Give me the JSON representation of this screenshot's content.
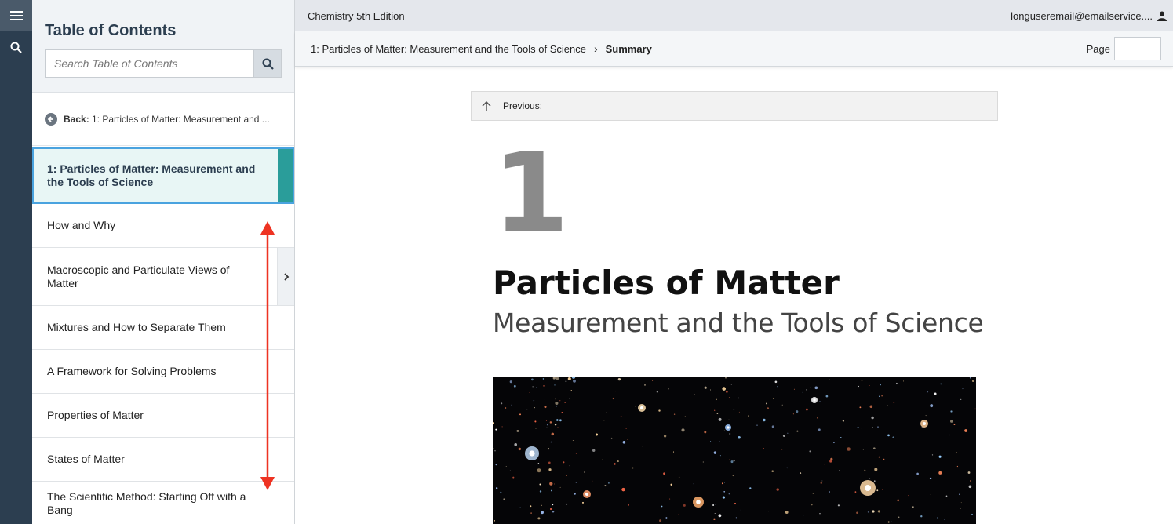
{
  "rail": {
    "menu_icon": "hamburger-menu-icon",
    "search_icon": "search-icon"
  },
  "sidebar": {
    "title": "Table of Contents",
    "search_placeholder": "Search Table of Contents",
    "back_prefix": "Back:",
    "back_text": "1: Particles of Matter: Measurement and ...",
    "active_item": "1: Particles of Matter: Measurement and the Tools of Science",
    "items": [
      {
        "label": "How and Why"
      },
      {
        "label": "Macroscopic and Particulate Views of Matter"
      },
      {
        "label": "Mixtures and How to Separate Them"
      },
      {
        "label": "A Framework for Solving Problems"
      },
      {
        "label": "Properties of Matter"
      },
      {
        "label": "States of Matter"
      },
      {
        "label": "The Scientific Method: Starting Off with a Bang"
      }
    ],
    "accent": "#2a9d9a",
    "annotation_color": "#ee3322"
  },
  "topbar": {
    "book_title": "Chemistry 5th Edition",
    "user_email": "longuseremail@emailservice...."
  },
  "breadcrumb": {
    "parent": "1: Particles of Matter: Measurement and the Tools of Science",
    "current": "Summary",
    "page_label": "Page"
  },
  "content": {
    "previous_label": "Previous:",
    "chapter_number": "1",
    "chapter_title": "Particles of Matter",
    "chapter_subtitle": "Measurement and the Tools of Science"
  }
}
